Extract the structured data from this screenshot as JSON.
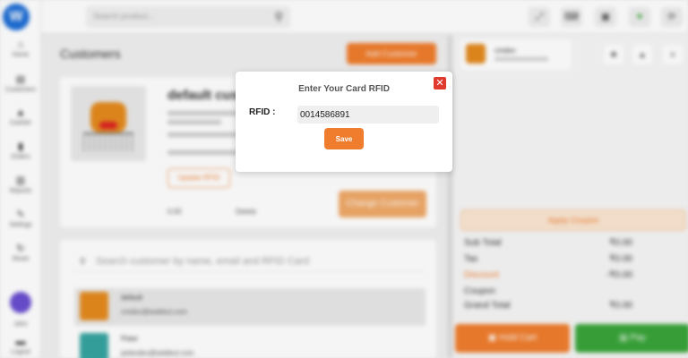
{
  "app": {
    "logo_text": "W"
  },
  "sidebar": {
    "items": [
      {
        "label": "Home",
        "icon": "home-icon",
        "glyph": "⌂"
      },
      {
        "label": "Customers",
        "icon": "customers-icon",
        "glyph": "▤"
      },
      {
        "label": "Cashier",
        "icon": "cashier-icon",
        "glyph": "▲"
      },
      {
        "label": "Orders",
        "icon": "orders-icon",
        "glyph": "▮"
      },
      {
        "label": "Reports",
        "icon": "reports-icon",
        "glyph": "▥"
      },
      {
        "label": "Settings",
        "icon": "settings-icon",
        "glyph": "✎"
      },
      {
        "label": "Reset",
        "icon": "reset-icon",
        "glyph": "↻"
      }
    ],
    "user_name": "John",
    "logout_label": "Logout"
  },
  "topbar": {
    "search_placeholder": "Search product...",
    "buttons": [
      {
        "name": "expand-icon",
        "glyph": "⤢"
      },
      {
        "name": "keyboard-icon",
        "glyph": "⌨"
      },
      {
        "name": "display-icon",
        "glyph": "▣"
      },
      {
        "name": "wifi-icon",
        "glyph": "♥"
      },
      {
        "name": "sync-icon",
        "glyph": "⟳"
      }
    ]
  },
  "main": {
    "title": "Customers",
    "add_customer_label": "Add Customer",
    "customer": {
      "name": "default custo",
      "update_rfid_label": "Update RFID",
      "change_customer_label": "Change Customer",
      "stat_left": "0.00",
      "stat_right": "Delete"
    },
    "list": {
      "search_placeholder": "Search customer by name, email and RFID Card",
      "rows": [
        {
          "name": "default",
          "email": "cmdev@webkul.com"
        },
        {
          "name": "Peter",
          "email": "peterdev@webkul.com"
        }
      ]
    }
  },
  "cart": {
    "customer_name": "cmdev",
    "apply_coupon_label": "Apply Coupon",
    "summary": [
      {
        "label": "Sub Total",
        "value": "₹0.00"
      },
      {
        "label": "Tax",
        "value": "₹0.00"
      },
      {
        "label": "Discount",
        "value": "-₹0.00"
      },
      {
        "label": "Coupon",
        "value": ""
      },
      {
        "label": "Grand Total",
        "value": "₹0.00"
      }
    ],
    "hold_label": "Hold Cart",
    "pay_label": "Pay"
  },
  "modal": {
    "title": "Enter Your Card RFID",
    "field_label": "RFID :",
    "rfid_value": "0014586891",
    "save_label": "Save",
    "close_glyph": "✕"
  }
}
